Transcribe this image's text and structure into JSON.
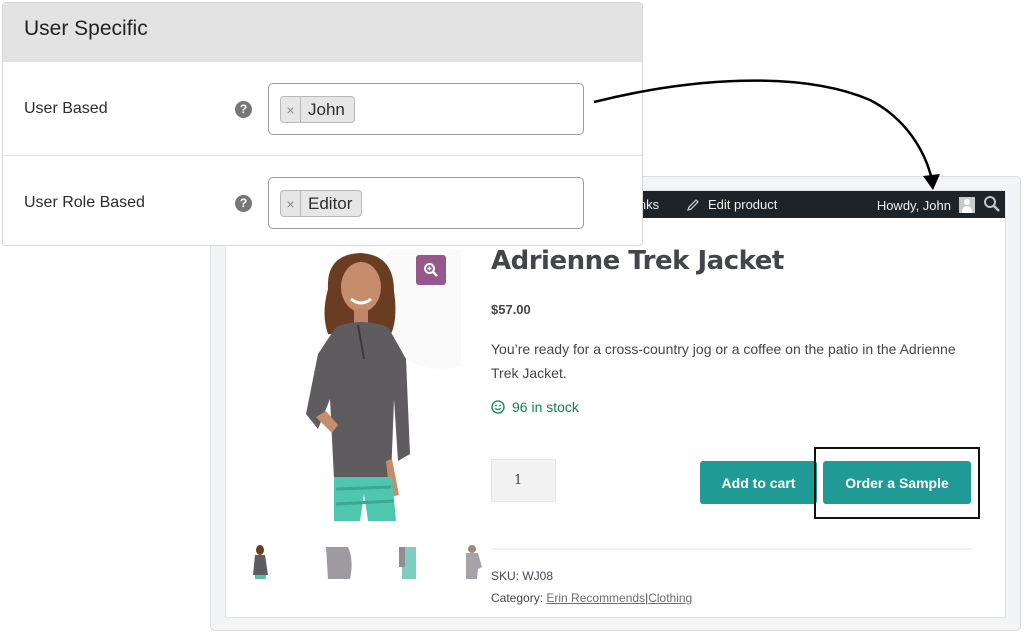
{
  "settings": {
    "title": "User Specific",
    "rows": [
      {
        "label": "User Based",
        "help_icon": "question-circle-icon",
        "tags": [
          "John"
        ],
        "remove_glyph": "×"
      },
      {
        "label": "User Role Based",
        "help_icon": "question-circle-icon",
        "tags": [
          "Editor"
        ],
        "remove_glyph": "×"
      }
    ]
  },
  "admin_bar": {
    "links_partial": "inks",
    "edit_product": "Edit product",
    "howdy": "Howdy, John",
    "icons": [
      "pencil-icon",
      "avatar-icon",
      "search-icon"
    ]
  },
  "product": {
    "title": "Adrienne Trek Jacket",
    "price": "$57.00",
    "description": "You’re ready for a cross-country jog or a coffee on the patio in the Adrienne Trek Jacket.",
    "stock": "96 in stock",
    "quantity": "1",
    "add_to_cart": "Add to cart",
    "order_sample": "Order a Sample",
    "sku_label": "SKU:",
    "sku": "WJ08",
    "category_label": "Category:",
    "categories": [
      "Erin Recommends",
      "Clothing"
    ],
    "category_separator": "|",
    "thumbnails": [
      "front",
      "side",
      "back-detail",
      "back"
    ]
  },
  "colors": {
    "accent_teal": "#1f9a94",
    "zoom_purple": "#96588a",
    "admin_bar": "#1d2327",
    "stock_green": "#0f834d"
  }
}
